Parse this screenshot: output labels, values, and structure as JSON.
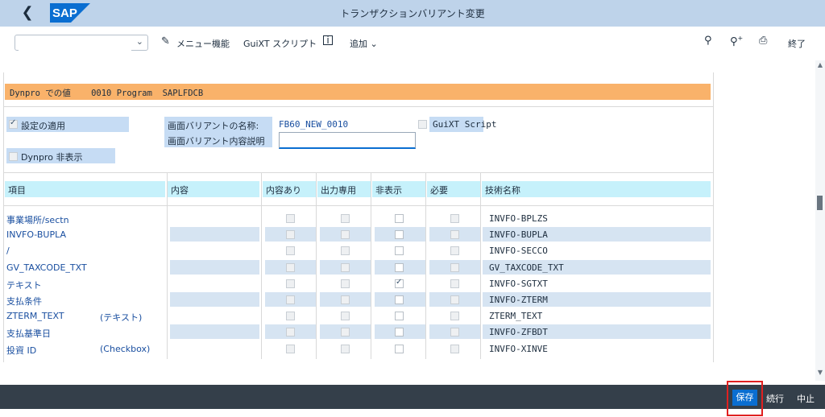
{
  "title": "トランザクションバリアント変更",
  "logo_text": "SAP",
  "toolbar": {
    "command_value": "",
    "menu_label": "メニュー機能",
    "guixt_label": "GuiXT スクリプト",
    "add_label": "追加",
    "exit_label": "終了"
  },
  "dynpro": {
    "label": "Dynpro での値",
    "number": "0010",
    "program_label": "Program",
    "program": "SAPLFDCB"
  },
  "settings": {
    "apply_label": "設定の適用",
    "apply_checked": true,
    "hide_dynpro_label": "Dynpro 非表示",
    "hide_dynpro_checked": false,
    "variant_name_label": "画面バリアントの名称:",
    "variant_name_value": "FB60_NEW_0010",
    "variant_desc_label": "画面バリアント内容説明",
    "variant_desc_value": "",
    "guixt_script_label": "GuiXT Script",
    "guixt_script_checked": false
  },
  "table": {
    "headers": [
      "項目",
      "内容",
      "内容あり",
      "出力専用",
      "非表示",
      "必要",
      "技術名称"
    ],
    "rows": [
      {
        "item": "事業場所/sectn",
        "sub": "",
        "tech": "INVFO-BPLZS",
        "hidden": false
      },
      {
        "item": "INVFO-BUPLA",
        "sub": "",
        "tech": "INVFO-BUPLA",
        "hidden": false
      },
      {
        "item": "/",
        "sub": "",
        "tech": "INVFO-SECCO",
        "hidden": false
      },
      {
        "item": "GV_TAXCODE_TXT",
        "sub": "",
        "tech": "GV_TAXCODE_TXT",
        "hidden": false
      },
      {
        "item": "テキスト",
        "sub": "",
        "tech": "INVFO-SGTXT",
        "hidden": true
      },
      {
        "item": "支払条件",
        "sub": "",
        "tech": "INVFO-ZTERM",
        "hidden": false
      },
      {
        "item": "ZTERM_TEXT",
        "sub": "(テキスト)",
        "tech": "ZTERM_TEXT",
        "hidden": false
      },
      {
        "item": "支払基準日",
        "sub": "",
        "tech": "INVFO-ZFBDT",
        "hidden": false
      },
      {
        "item": "投資 ID",
        "sub": "(Checkbox)",
        "tech": "INVFO-XINVE",
        "hidden": false
      }
    ]
  },
  "footer": {
    "save_label": "保存",
    "continue_label": "続行",
    "cancel_label": "中止"
  },
  "colors": {
    "titlebar": "#bed3ea",
    "dynpro_header": "#f9b26a",
    "label_bg": "#c6dcf4",
    "table_header": "#c6f1fb",
    "footer": "#343f4a",
    "save_button": "#0a6ed1",
    "highlight": "#e02020"
  }
}
